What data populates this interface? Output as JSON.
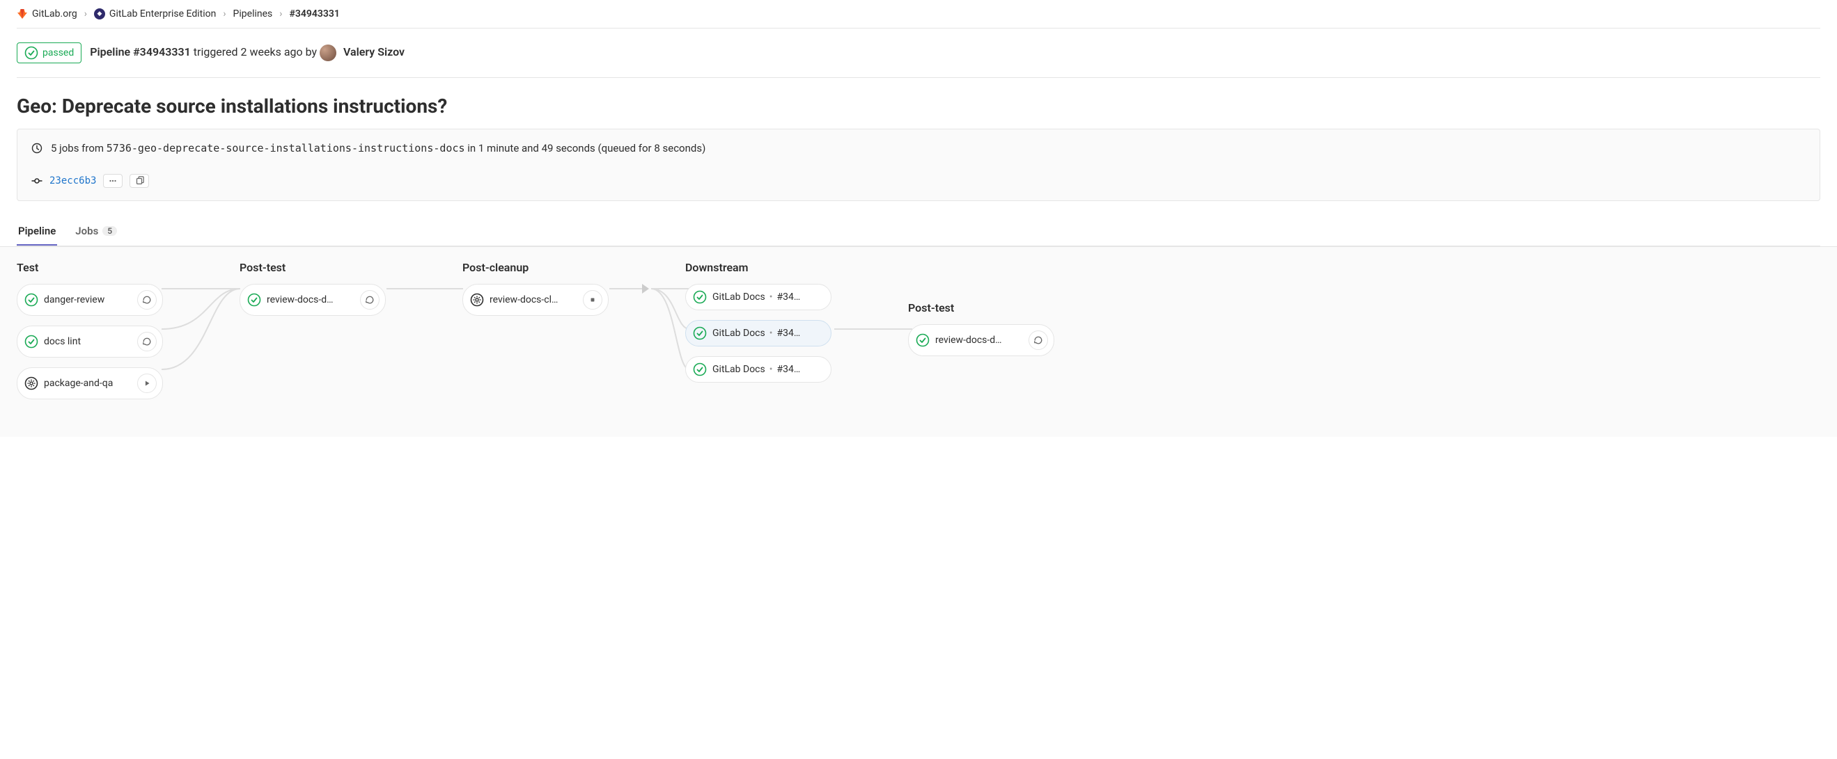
{
  "breadcrumb": {
    "org": "GitLab.org",
    "project": "GitLab Enterprise Edition",
    "section": "Pipelines",
    "current": "#34943331"
  },
  "status": {
    "label": "passed"
  },
  "header": {
    "pipeline_label": "Pipeline #34943331",
    "trigger_text": " triggered 2 weeks ago by ",
    "author": "Valery Sizov"
  },
  "title": "Geo: Deprecate source installations instructions?",
  "info": {
    "jobs_text_prefix": "5 jobs from ",
    "branch": "5736-geo-deprecate-source-installations-instructions-docs",
    "duration_text": " in 1 minute and 49 seconds (queued for 8 seconds)",
    "commit_sha": "23ecc6b3"
  },
  "tabs": {
    "pipeline": "Pipeline",
    "jobs": "Jobs",
    "jobs_count": "5"
  },
  "stages": {
    "test": {
      "title": "Test",
      "jobs": [
        {
          "name": "danger-review",
          "status": "passed",
          "action": "retry"
        },
        {
          "name": "docs lint",
          "status": "passed",
          "action": "retry"
        },
        {
          "name": "package-and-qa",
          "status": "manual",
          "action": "play"
        }
      ]
    },
    "post_test": {
      "title": "Post-test",
      "jobs": [
        {
          "name": "review-docs-d…",
          "status": "passed",
          "action": "retry"
        }
      ]
    },
    "post_cleanup": {
      "title": "Post-cleanup",
      "jobs": [
        {
          "name": "review-docs-cl…",
          "status": "manual",
          "action": "stop"
        }
      ]
    },
    "downstream": {
      "title": "Downstream",
      "jobs": [
        {
          "name": "GitLab Docs",
          "ref": "#34…",
          "status": "passed"
        },
        {
          "name": "GitLab Docs",
          "ref": "#34…",
          "status": "passed",
          "highlight": true
        },
        {
          "name": "GitLab Docs",
          "ref": "#34…",
          "status": "passed"
        }
      ]
    },
    "ds_post_test": {
      "title": "Post-test",
      "jobs": [
        {
          "name": "review-docs-d…",
          "status": "passed",
          "action": "retry"
        }
      ]
    }
  }
}
